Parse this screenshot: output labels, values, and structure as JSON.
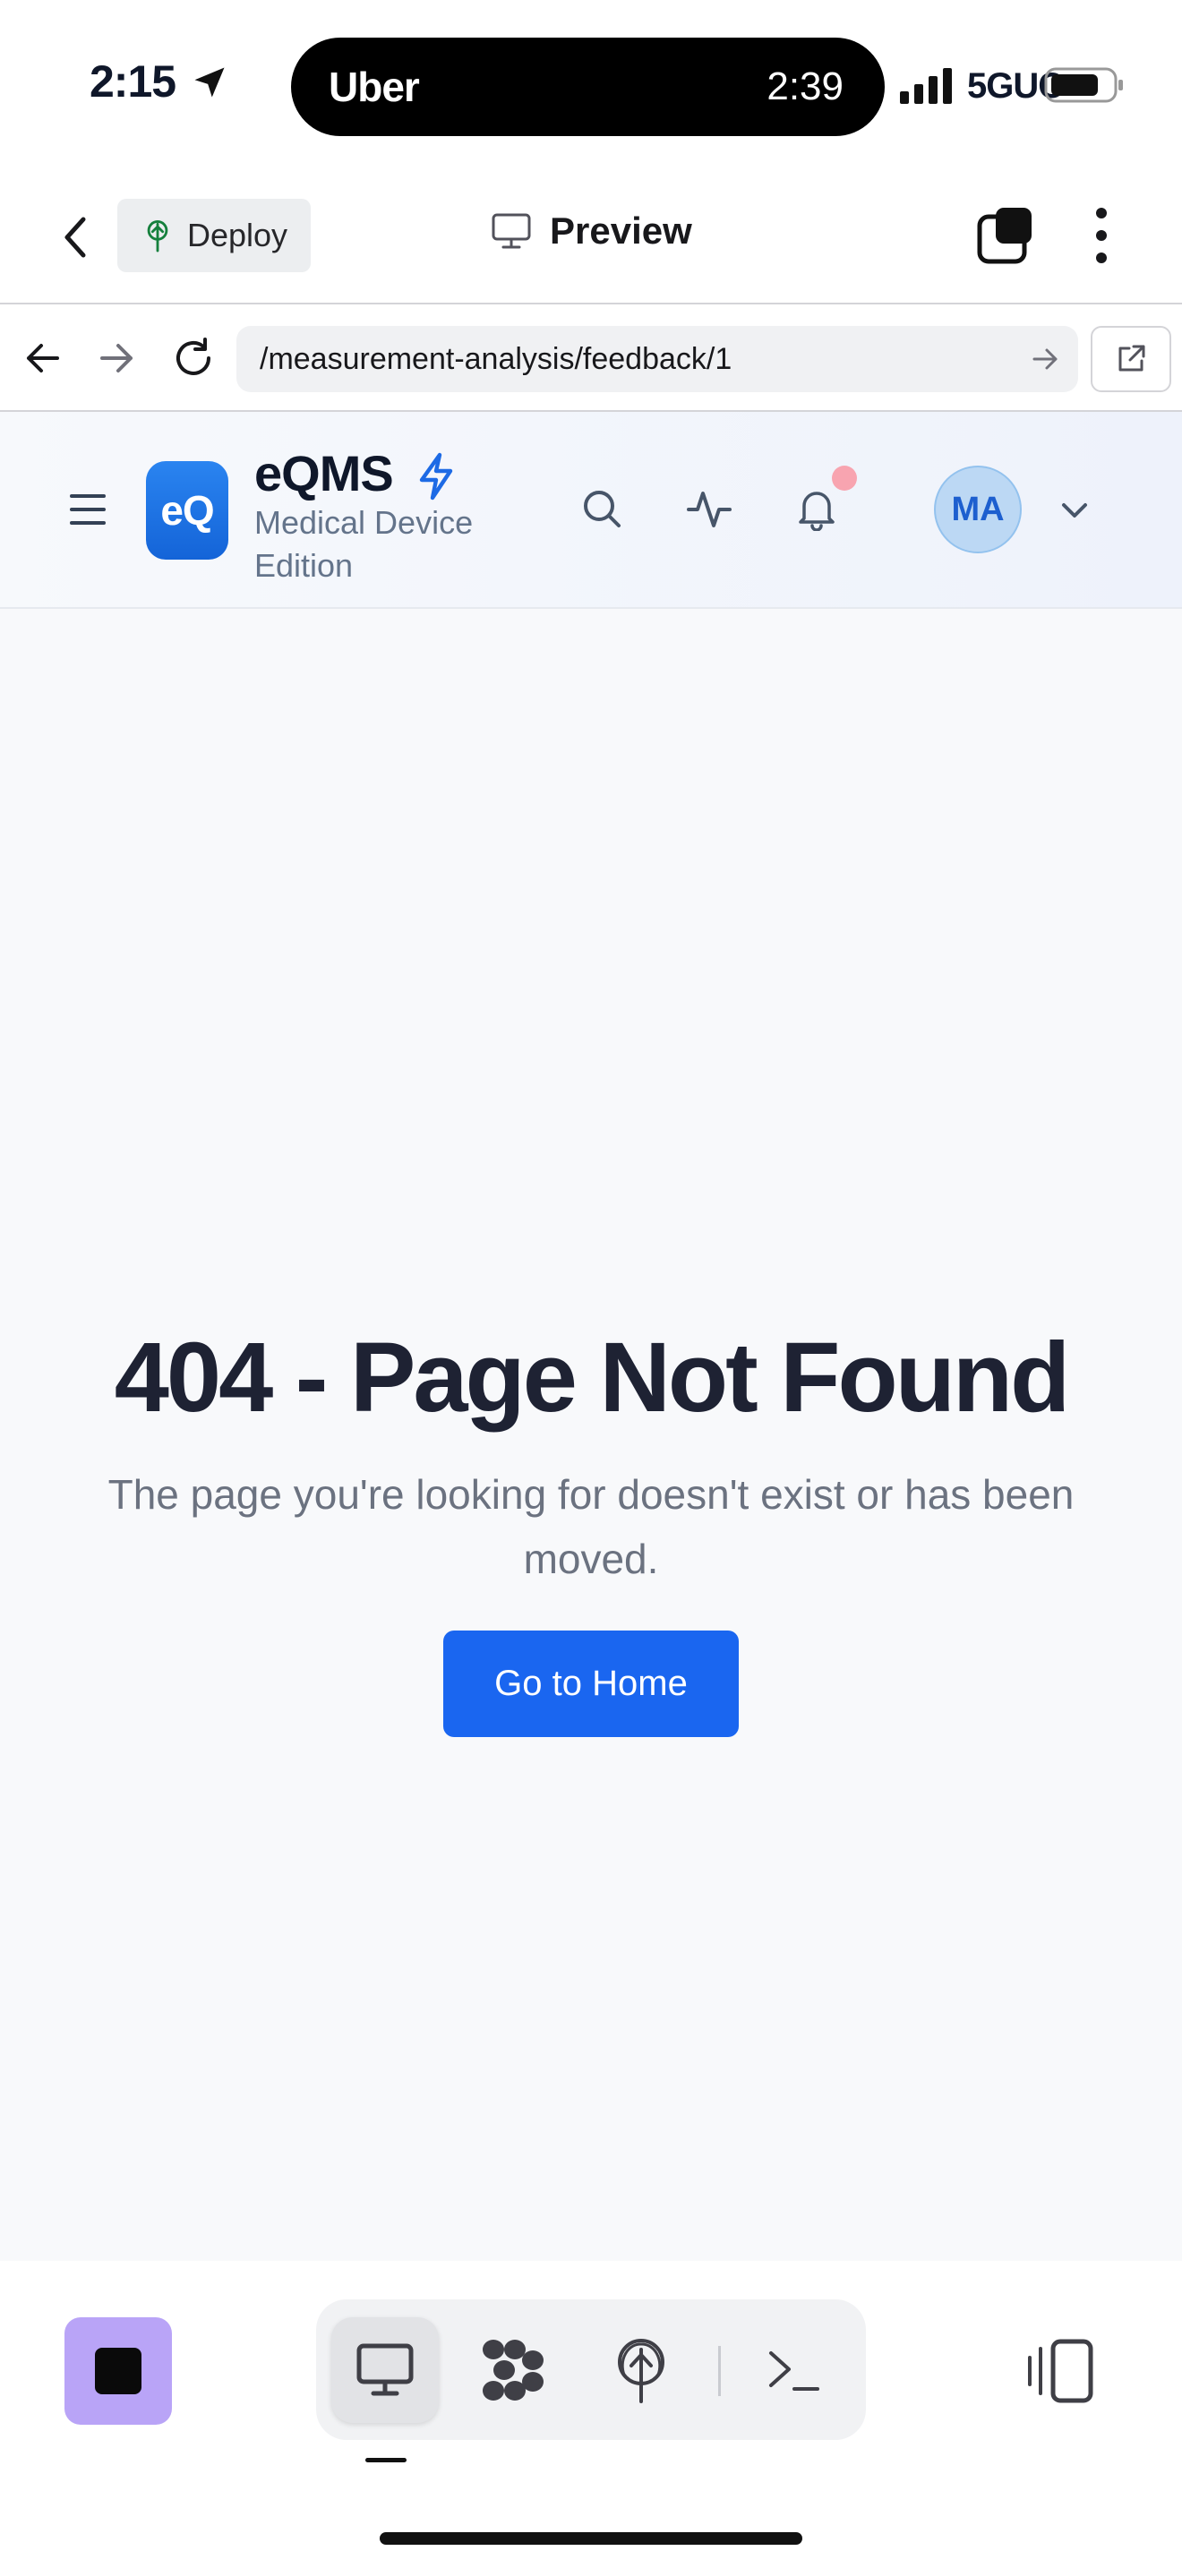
{
  "status_bar": {
    "time": "2:15",
    "island_app": "Uber",
    "island_time": "2:39",
    "network": "5GUC"
  },
  "app_bar": {
    "deploy_label": "Deploy",
    "title": "Preview"
  },
  "url_bar": {
    "url": "/measurement-analysis/feedback/1"
  },
  "web_header": {
    "logo_text": "eQ",
    "title": "eQMS",
    "subtitle": "Medical Device Edition",
    "avatar_initials": "MA"
  },
  "content": {
    "error_title": "404 - Page Not Found",
    "error_message": "The page you're looking for doesn't exist or has been moved.",
    "home_button_label": "Go to Home"
  },
  "colors": {
    "primary_button": "#1a66f0",
    "logo_blue": "#1f73e6",
    "stop_button": "#b9a4f7",
    "notification_dot": "#f8a4b0"
  },
  "icons": {
    "status": [
      "location-arrow-icon",
      "signal-icon",
      "battery-icon"
    ],
    "app_bar": [
      "chevron-left-icon",
      "deploy-tree-icon",
      "monitor-icon",
      "tabs-icon",
      "more-vertical-icon"
    ],
    "url_bar": [
      "arrow-left-icon",
      "arrow-right-icon",
      "reload-icon",
      "arrow-right-small-icon",
      "external-link-icon"
    ],
    "header": [
      "menu-icon",
      "bolt-icon",
      "search-icon",
      "activity-icon",
      "bell-icon",
      "chevron-down-icon"
    ],
    "toolbar": [
      "stop-icon",
      "monitor-icon",
      "workspace-icon",
      "deploy-icon",
      "terminal-icon",
      "layout-panels-icon"
    ]
  }
}
